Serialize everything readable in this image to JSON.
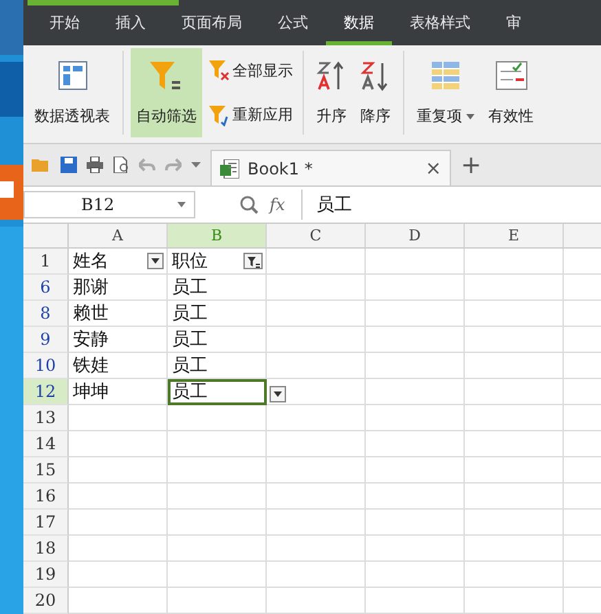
{
  "menu_tabs": [
    {
      "label": "开始",
      "selected": false
    },
    {
      "label": "插入",
      "selected": false
    },
    {
      "label": "页面布局",
      "selected": false
    },
    {
      "label": "公式",
      "selected": false
    },
    {
      "label": "数据",
      "selected": true
    },
    {
      "label": "表格样式",
      "selected": false
    },
    {
      "label": "审",
      "selected": false
    }
  ],
  "ribbon": {
    "pivot": "数据透视表",
    "autofilter": {
      "label": "自动筛选",
      "selected": true
    },
    "show_all": "全部显示",
    "reapply": "重新应用",
    "sort_asc": "升序",
    "sort_desc": "降序",
    "duplicates": "重复项",
    "validity": "有效性"
  },
  "document_tab": {
    "title": "Book1 *",
    "close": "×",
    "new_tab": "+"
  },
  "formula_bar": {
    "cell_ref": "B12",
    "fx": "fx",
    "value": "员工"
  },
  "columns": [
    {
      "label": "A",
      "selected": false,
      "kind": "dropdown"
    },
    {
      "label": "B",
      "selected": true,
      "kind": "filtered"
    },
    {
      "label": "C",
      "selected": false
    },
    {
      "label": "D",
      "selected": false
    },
    {
      "label": "E",
      "selected": false
    }
  ],
  "rows": [
    {
      "number": "1",
      "filtered": false,
      "selected": false,
      "cells": [
        "姓名",
        "职位"
      ]
    },
    {
      "number": "6",
      "filtered": true,
      "selected": false,
      "cells": [
        "那谢",
        "员工"
      ]
    },
    {
      "number": "8",
      "filtered": true,
      "selected": false,
      "cells": [
        "赖世",
        "员工"
      ]
    },
    {
      "number": "9",
      "filtered": true,
      "selected": false,
      "cells": [
        "安静",
        "员工"
      ]
    },
    {
      "number": "10",
      "filtered": true,
      "selected": false,
      "cells": [
        "铁娃",
        "员工"
      ]
    },
    {
      "number": "12",
      "filtered": true,
      "selected": true,
      "cells": [
        "坤坤",
        "员工"
      ]
    },
    {
      "number": "13",
      "filtered": false,
      "selected": false,
      "cells": []
    },
    {
      "number": "14",
      "filtered": false,
      "selected": false,
      "cells": []
    },
    {
      "number": "15",
      "filtered": false,
      "selected": false,
      "cells": []
    },
    {
      "number": "16",
      "filtered": false,
      "selected": false,
      "cells": []
    },
    {
      "number": "17",
      "filtered": false,
      "selected": false,
      "cells": []
    },
    {
      "number": "18",
      "filtered": false,
      "selected": false,
      "cells": []
    },
    {
      "number": "19",
      "filtered": false,
      "selected": false,
      "cells": []
    },
    {
      "number": "20",
      "filtered": false,
      "selected": false,
      "cells": []
    }
  ]
}
